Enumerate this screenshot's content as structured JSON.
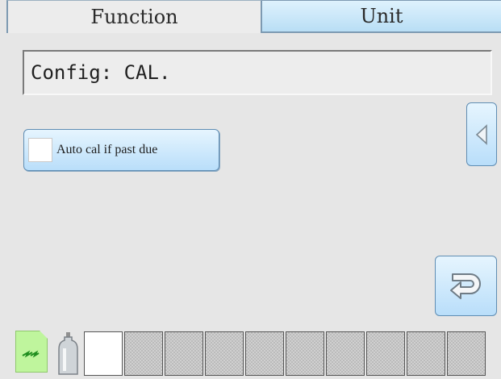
{
  "tabs": [
    {
      "label": "Function",
      "active": true
    },
    {
      "label": "Unit",
      "active": false
    }
  ],
  "config_title": "Config: CAL.",
  "auto_cal": {
    "label": "Auto cal if past due",
    "checked": false
  },
  "buttons": {
    "left_icon": "triangle-left-icon",
    "return_icon": "return-arrow-icon"
  },
  "status_bar": {
    "sd_icon": "sd-card-icon",
    "gas_icon": "gas-cylinder-icon",
    "slots": [
      "empty",
      "filled",
      "filled",
      "filled",
      "filled",
      "filled",
      "filled",
      "filled",
      "filled",
      "filled"
    ]
  },
  "colors": {
    "accent": "#b9defa",
    "border": "#5f8db3",
    "sd_green": "#bff59d"
  }
}
